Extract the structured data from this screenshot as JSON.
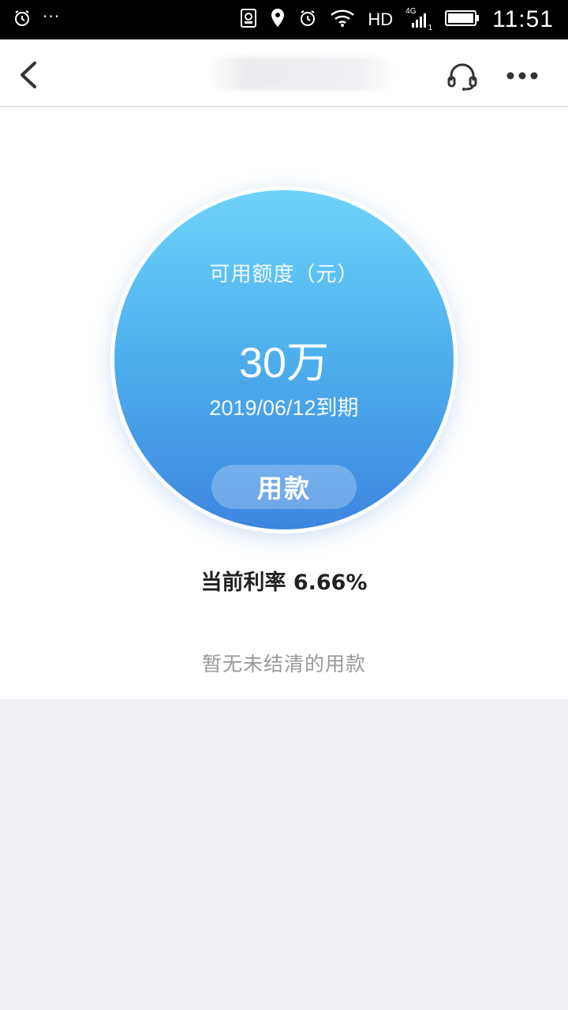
{
  "status_bar": {
    "dots": "···",
    "network_type": "HD",
    "network_gen": "4G",
    "sim_slot": "1",
    "time": "11:51"
  },
  "nav": {
    "back_icon": "chevron-left-icon",
    "support_icon": "headset-icon",
    "more_icon": "more-dots-icon"
  },
  "credit": {
    "label": "可用额度（元）",
    "amount": "30万",
    "due": "2019/06/12到期",
    "button_label": "用款"
  },
  "rate_text": "当前利率 6.66%",
  "empty_note": "暂无未结清的用款",
  "colors": {
    "gradient_top": "#6fd3fa",
    "gradient_bottom": "#3d86e0",
    "page_bg": "#efeff4"
  }
}
